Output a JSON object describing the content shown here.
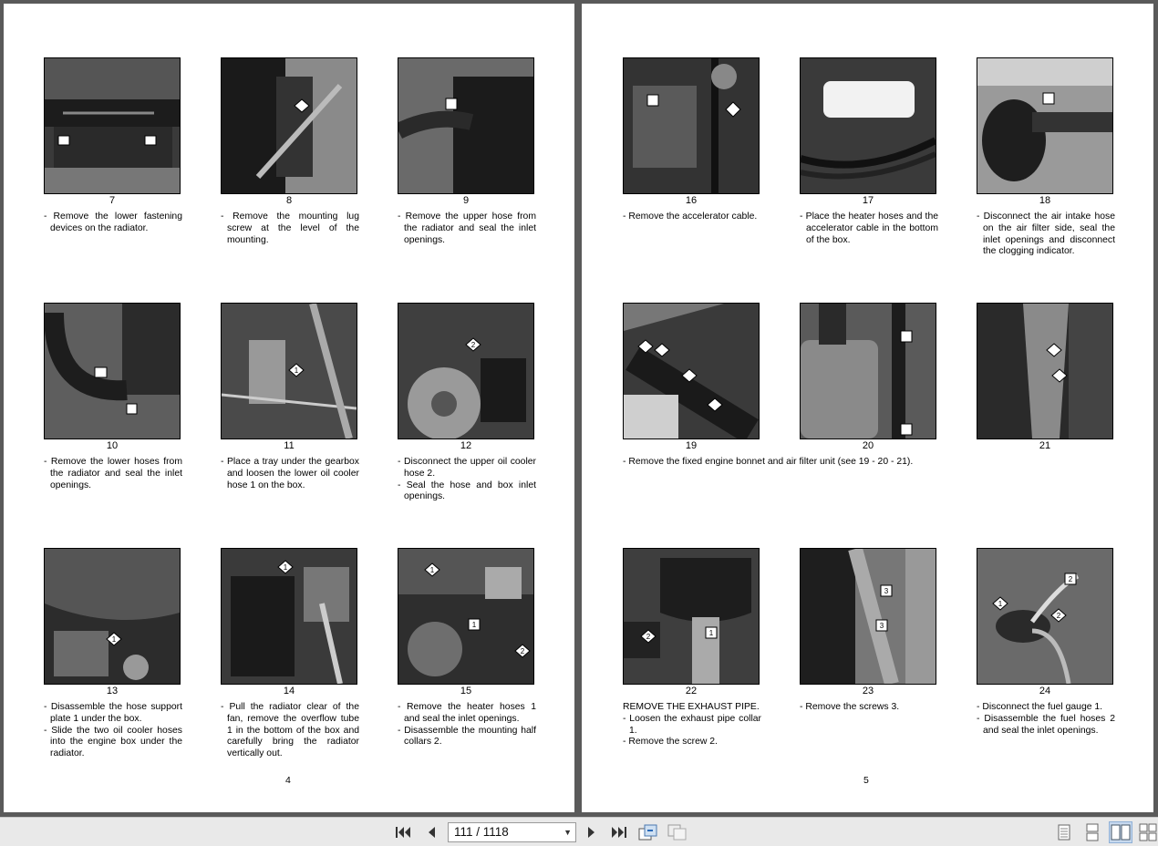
{
  "left_page": {
    "page_number": "4",
    "figures": [
      {
        "num": "7",
        "caption": [
          {
            "t": "- Remove the lower fastening devices on the radiator."
          }
        ]
      },
      {
        "num": "8",
        "caption": [
          {
            "t": "- Remove the mounting lug screw at the level of the mounting."
          }
        ]
      },
      {
        "num": "9",
        "caption": [
          {
            "t": "- Remove the upper hose from the radiator and seal the inlet openings."
          }
        ]
      },
      {
        "num": "10",
        "caption": [
          {
            "t": "- Remove the lower hoses from the radiator and seal the inlet openings."
          }
        ]
      },
      {
        "num": "11",
        "caption": [
          {
            "t": "- Place a tray under the gearbox and loosen the lower oil cooler hose 1 on the box."
          }
        ]
      },
      {
        "num": "12",
        "caption": [
          {
            "t": "- Disconnect the upper oil cooler hose 2."
          },
          {
            "t": "- Seal the hose and box inlet openings."
          }
        ]
      },
      {
        "num": "13",
        "caption": [
          {
            "t": "- Disassemble the hose support plate 1 under the box."
          },
          {
            "t": "- Slide the two oil cooler hoses into the engine box under the radiator."
          }
        ]
      },
      {
        "num": "14",
        "caption": [
          {
            "t": "- Pull the radiator clear of the fan, remove the overflow tube 1 in the bottom of the box and carefully bring the radiator vertically out."
          }
        ]
      },
      {
        "num": "15",
        "caption": [
          {
            "t": "- Remove the heater hoses 1 and seal the inlet openings."
          },
          {
            "t": "- Disassemble the mounting half collars 2."
          }
        ]
      }
    ]
  },
  "right_page": {
    "page_number": "5",
    "figures": [
      {
        "num": "16",
        "caption": [
          {
            "t": "- Remove the accelerator cable."
          }
        ]
      },
      {
        "num": "17",
        "caption": [
          {
            "t": "- Place the heater hoses and the accelerator cable in the bottom of the box."
          }
        ]
      },
      {
        "num": "18",
        "caption": [
          {
            "t": "- Disconnect the air intake hose on the air filter side, seal the inlet openings and disconnect the clogging indicator."
          }
        ]
      },
      {
        "num": "19",
        "caption": []
      },
      {
        "num": "20",
        "caption": []
      },
      {
        "num": "21",
        "caption": []
      },
      {
        "num": "22",
        "caption": [
          {
            "t": "REMOVE THE EXHAUST PIPE.",
            "plain": true
          },
          {
            "t": "- Loosen the exhaust pipe collar 1."
          },
          {
            "t": "- Remove the screw 2."
          }
        ]
      },
      {
        "num": "23",
        "caption": [
          {
            "t": "- Remove the screws 3."
          }
        ]
      },
      {
        "num": "24",
        "caption": [
          {
            "t": "- Disconnect the fuel gauge 1."
          },
          {
            "t": "- Disassemble the fuel hoses 2 and seal the inlet openings."
          }
        ]
      }
    ],
    "row2_caption": "- Remove the fixed engine bonnet and air filter unit (see 19 - 20 - 21)."
  },
  "toolbar": {
    "page_indicator": "111 / 1118",
    "first_icon": "first-page-icon",
    "prev_icon": "previous-page-icon",
    "next_icon": "next-page-icon",
    "last_icon": "last-page-icon"
  },
  "callouts": {
    "f11": "1",
    "f12": "2",
    "f13": "1",
    "f14": "1",
    "f15a": "1",
    "f15b": "1",
    "f15c": "2",
    "f22a": "1",
    "f22b": "2",
    "f23a": "3",
    "f23b": "3",
    "f24a": "2",
    "f24b": "1",
    "f24c": "2"
  }
}
